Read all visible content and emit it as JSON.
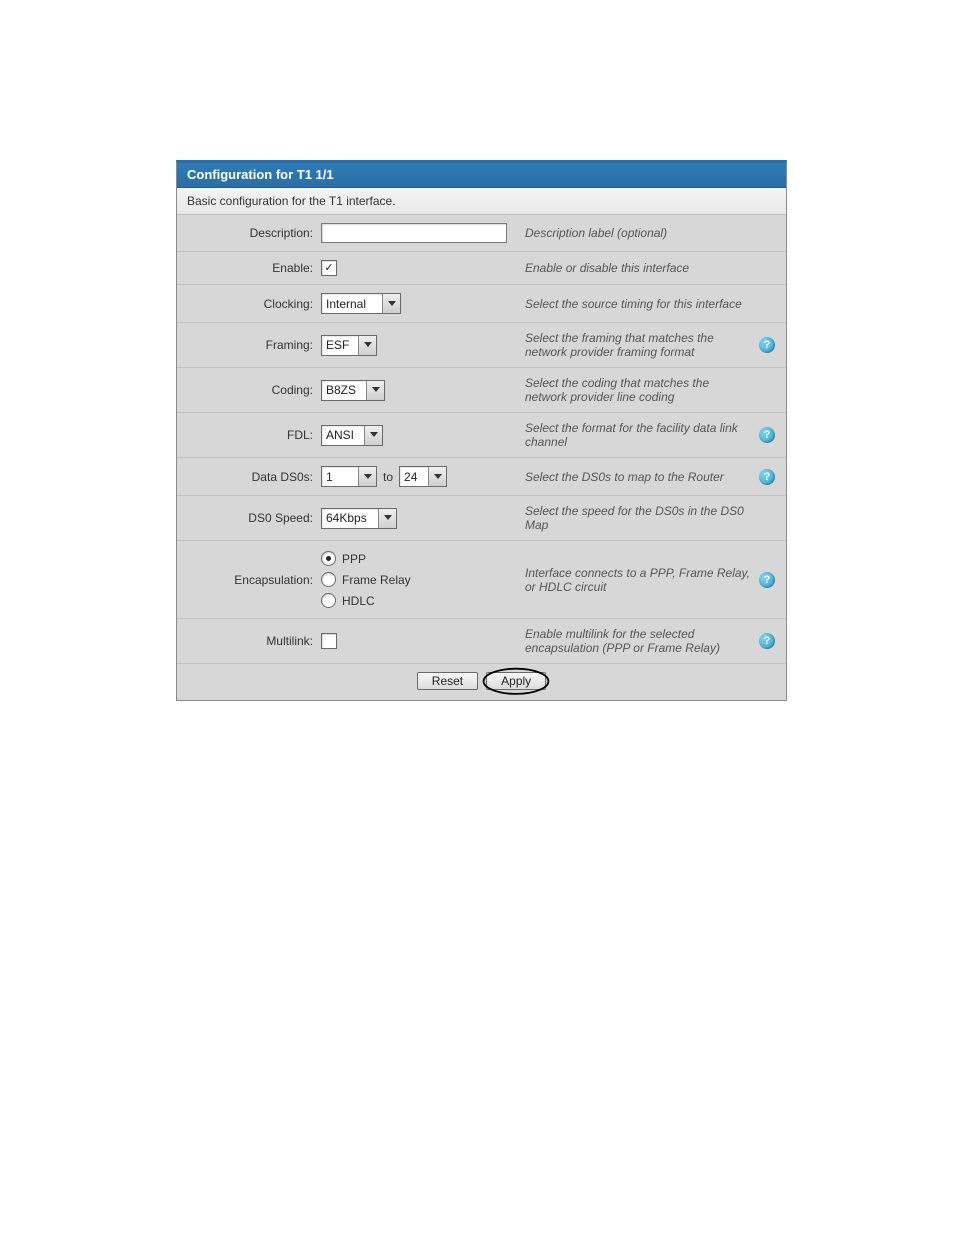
{
  "header": {
    "title": "Configuration for T1 1/1",
    "subtitle": "Basic configuration for the T1 interface."
  },
  "fields": {
    "description": {
      "label": "Description:",
      "value": "",
      "hint": "Description label (optional)",
      "help": false
    },
    "enable": {
      "label": "Enable:",
      "checked": true,
      "hint": "Enable or disable this interface",
      "help": false
    },
    "clocking": {
      "label": "Clocking:",
      "value": "Internal",
      "hint": "Select the source timing for this interface",
      "help": false
    },
    "framing": {
      "label": "Framing:",
      "value": "ESF",
      "hint": "Select the framing that matches the network provider framing format",
      "help": true
    },
    "coding": {
      "label": "Coding:",
      "value": "B8ZS",
      "hint": "Select the coding that matches the network provider line coding",
      "help": false
    },
    "fdl": {
      "label": "FDL:",
      "value": "ANSI",
      "hint": "Select the format for the facility data link channel",
      "help": true
    },
    "ds0s": {
      "label": "Data DS0s:",
      "from": "1",
      "to_text": "to",
      "to": "24",
      "hint": "Select the DS0s to map to the Router",
      "help": true
    },
    "ds0speed": {
      "label": "DS0 Speed:",
      "value": "64Kbps",
      "hint": "Select the speed for the DS0s in the DS0 Map",
      "help": false
    },
    "encapsulation": {
      "label": "Encapsulation:",
      "options": [
        "PPP",
        "Frame Relay",
        "HDLC"
      ],
      "selected": "PPP",
      "hint": "Interface connects to a PPP, Frame Relay, or HDLC circuit",
      "help": true
    },
    "multilink": {
      "label": "Multilink:",
      "checked": false,
      "hint": "Enable multilink for the selected encapsulation (PPP or Frame Relay)",
      "help": true
    }
  },
  "buttons": {
    "reset": "Reset",
    "apply": "Apply"
  }
}
